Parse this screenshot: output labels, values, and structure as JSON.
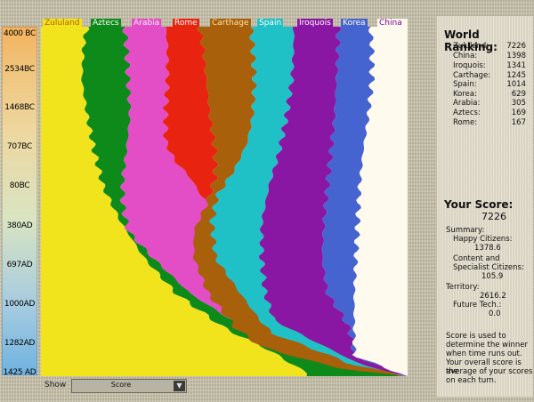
{
  "time_axis": [
    "4000 BC",
    "2534BC",
    "1468BC",
    "707BC",
    "80BC",
    "380AD",
    "697AD",
    "1000AD",
    "1282AD",
    "1425 AD"
  ],
  "civs": [
    {
      "label": "Zululand",
      "bg": "#f2e41c",
      "fg": "#b66000"
    },
    {
      "label": "Aztecs",
      "bg": "#0d8a1a",
      "fg": "#ffffff"
    },
    {
      "label": "Arabia",
      "bg": "#e34ec7",
      "fg": "#fff0fb"
    },
    {
      "label": "Rome",
      "bg": "#e82410",
      "fg": "#ffffff"
    },
    {
      "label": "Carthage",
      "bg": "#a8600a",
      "fg": "#ffe2a8"
    },
    {
      "label": "Spain",
      "bg": "#1fc1c6",
      "fg": "#ffffff"
    },
    {
      "label": "Iroquois",
      "bg": "#8a16a4",
      "fg": "#ffffff"
    },
    {
      "label": "Korea",
      "bg": "#4664d0",
      "fg": "#ffffff"
    },
    {
      "label": "China",
      "bg": "#fffaee",
      "fg": "#7a00a0"
    }
  ],
  "show": {
    "label": "Show",
    "value": "Score"
  },
  "ranking": {
    "title": "World Ranking:",
    "rows": [
      {
        "name": "Zululand:",
        "value": "7226"
      },
      {
        "name": "China:",
        "value": "1398"
      },
      {
        "name": "Iroquois:",
        "value": "1341"
      },
      {
        "name": "Carthage:",
        "value": "1245"
      },
      {
        "name": "Spain:",
        "value": "1014"
      },
      {
        "name": "Korea:",
        "value": "629"
      },
      {
        "name": "Arabia:",
        "value": "305"
      },
      {
        "name": "Aztecs:",
        "value": "169"
      },
      {
        "name": "Rome:",
        "value": "167"
      }
    ]
  },
  "your_score": {
    "title": "Your Score:",
    "value": "7226",
    "summary_label": "Summary:",
    "happy_label": "Happy Citizens:",
    "happy_value": "1378.6",
    "content_label_1": "Content and",
    "content_label_2": "Specialist Citizens:",
    "content_value": "105.9",
    "territory_label": "Territory:",
    "territory_value": "2616.2",
    "future_label": "Future Tech.:",
    "future_value": "0.0",
    "note_1": "Score is used to",
    "note_2": "determine the winner",
    "note_3": "when time runs out.",
    "note_4": "Your overall score is the",
    "note_5": "average of your scores",
    "note_6": "on each turn."
  }
}
